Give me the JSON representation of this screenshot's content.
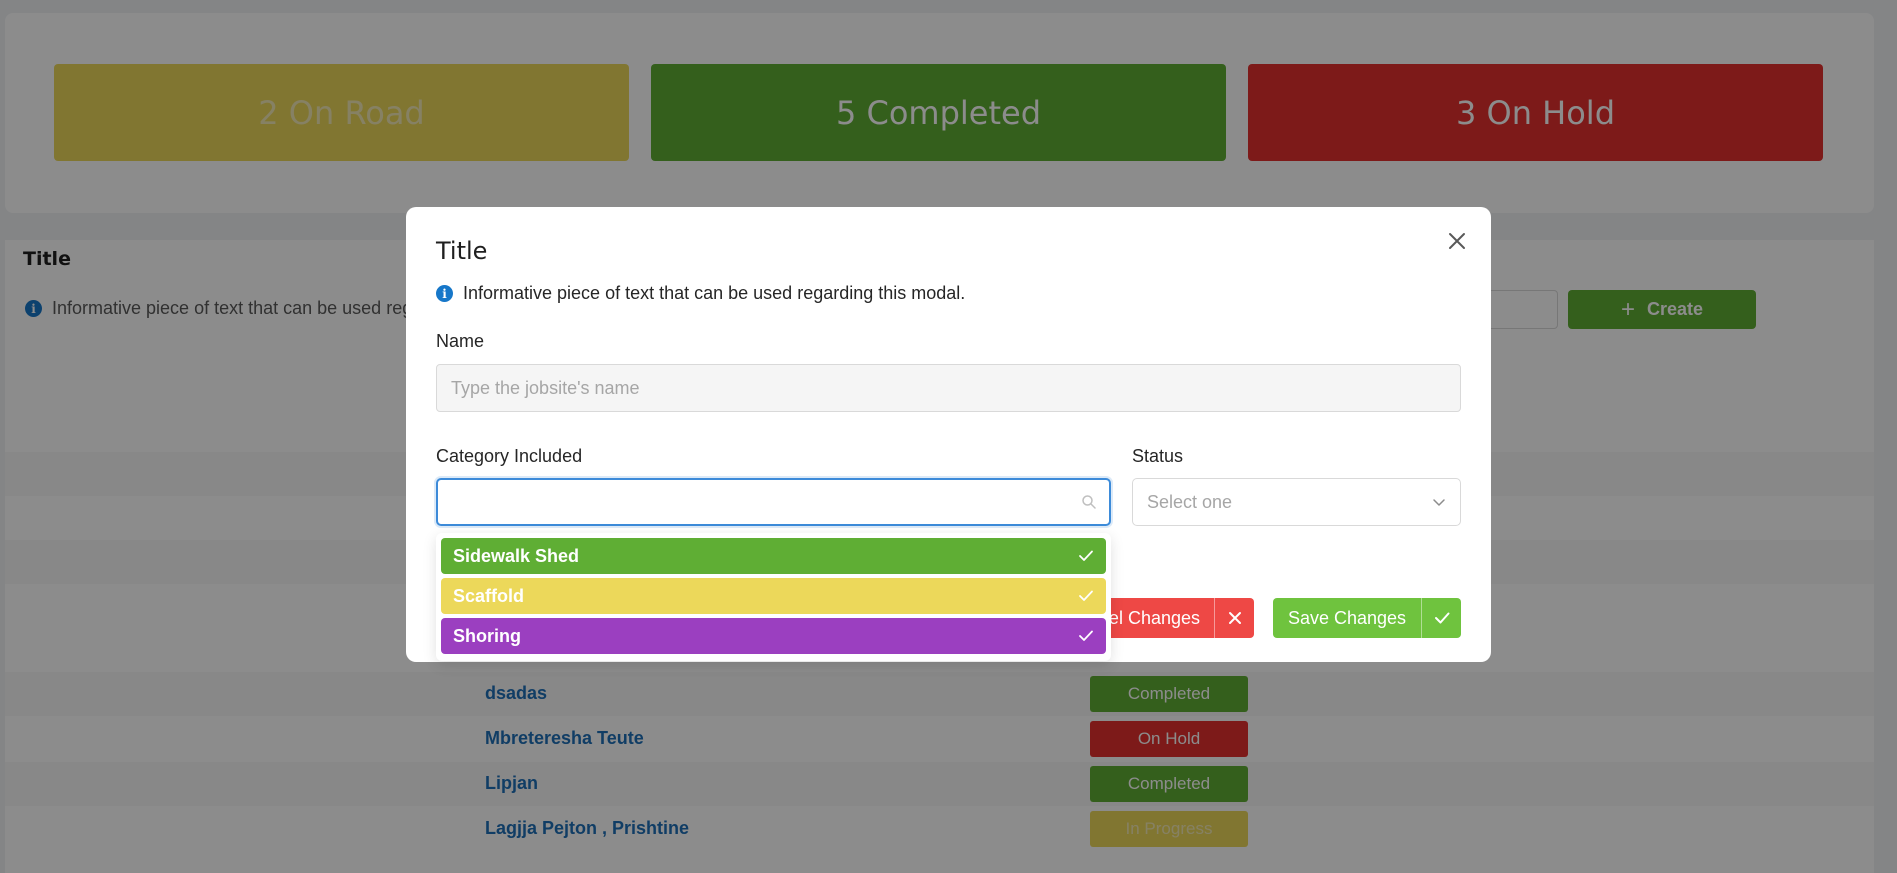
{
  "stats": {
    "on_road": "2 On Road",
    "completed": "5 Completed",
    "on_hold": "3 On Hold"
  },
  "table": {
    "title": "Title",
    "info_text": "Informative piece of text that can be used rega",
    "create_label": "Create",
    "rows": [
      {
        "name": "dsadas",
        "status": "Completed"
      },
      {
        "name": "Mbreteresha Teute",
        "status": "On Hold"
      },
      {
        "name": "Lipjan",
        "status": "Completed"
      },
      {
        "name": "Lagjja Pejton , Prishtine",
        "status": "In Progress"
      }
    ]
  },
  "modal": {
    "title": "Title",
    "info_text": "Informative piece of text that can be used regarding this modal.",
    "name_label": "Name",
    "name_placeholder": "Type the jobsite's name",
    "category_label": "Category Included",
    "category_value": "",
    "status_label": "Status",
    "status_placeholder": "Select one",
    "category_options": [
      {
        "label": "Sidewalk Shed",
        "color": "#5fae34",
        "selected": true
      },
      {
        "label": "Scaffold",
        "color": "#ecd85a",
        "selected": true
      },
      {
        "label": "Shoring",
        "color": "#9b3fc0",
        "selected": true
      }
    ],
    "cancel_label": "ncel Changes",
    "save_label": "Save Changes"
  },
  "colors": {
    "green": "#5fae34",
    "red": "#e4302e",
    "yellow": "#ecd85a",
    "purple": "#9b3fc0",
    "accent_blue": "#3d8bd9"
  }
}
